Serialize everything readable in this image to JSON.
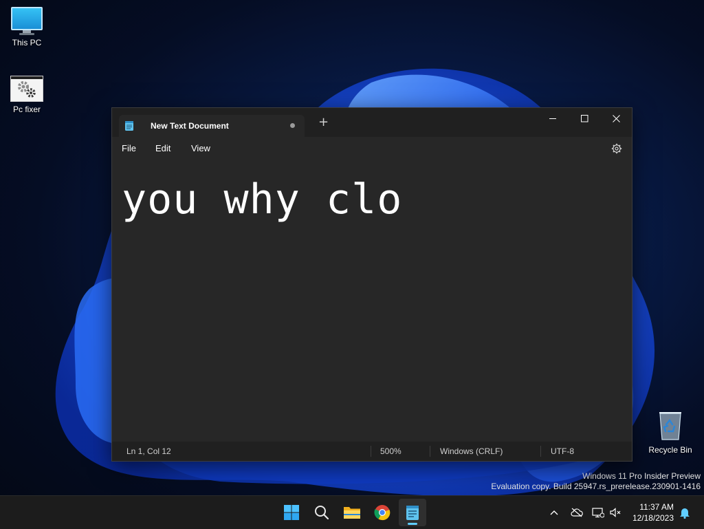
{
  "desktop": {
    "icons": [
      {
        "label": "This PC"
      },
      {
        "label": "Pc fixer"
      },
      {
        "label": "Recycle Bin"
      }
    ],
    "watermark": {
      "line1": "Windows 11 Pro Insider Preview",
      "line2": "Evaluation copy. Build 25947.rs_prerelease.230901-1416"
    }
  },
  "notepad": {
    "tab_title": "New Text Document",
    "new_tab_label": "+",
    "menu": [
      "File",
      "Edit",
      "View"
    ],
    "content": "you why clo",
    "status": {
      "position": "Ln 1, Col 12",
      "zoom": "500%",
      "line_ending": "Windows (CRLF)",
      "encoding": "UTF-8"
    }
  },
  "taskbar": {
    "apps": [
      "start-icon",
      "search-icon",
      "file-explorer-icon",
      "chrome-icon",
      "notepad-icon"
    ],
    "clock": {
      "time": "11:37 AM",
      "date": "12/18/2023"
    }
  },
  "colors": {
    "accent": "#60cdff",
    "window_bg": "#272727",
    "titlebar_bg": "#202020",
    "taskbar_bg": "#1c1c1c"
  }
}
